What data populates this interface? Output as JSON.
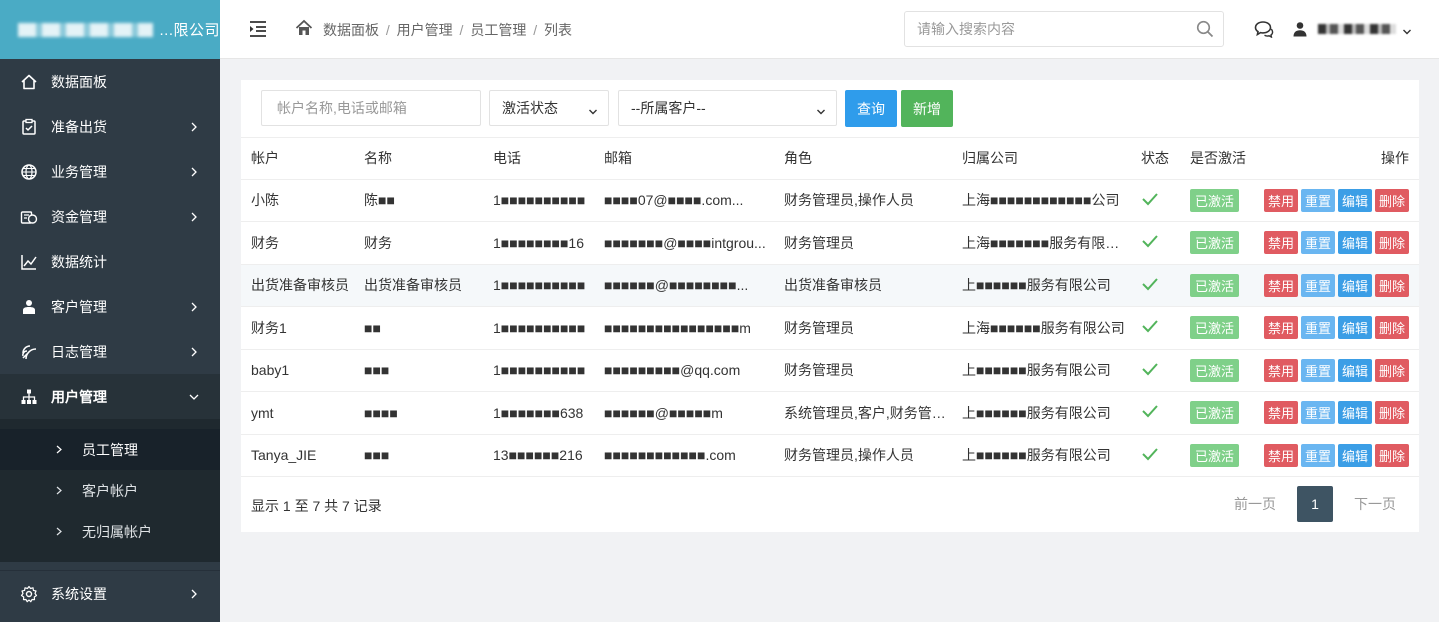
{
  "brand": {
    "title_suffix": "...限公司"
  },
  "sidebar": {
    "items": [
      {
        "label": "数据面板",
        "icon": "home-icon",
        "has_children": false
      },
      {
        "label": "准备出货",
        "icon": "clipboard-icon",
        "has_children": true
      },
      {
        "label": "业务管理",
        "icon": "globe-icon",
        "has_children": true
      },
      {
        "label": "资金管理",
        "icon": "money-icon",
        "has_children": true
      },
      {
        "label": "数据统计",
        "icon": "line-chart-icon",
        "has_children": false
      },
      {
        "label": "客户管理",
        "icon": "person-icon",
        "has_children": true
      },
      {
        "label": "日志管理",
        "icon": "log-icon",
        "has_children": true
      },
      {
        "label": "用户管理",
        "icon": "org-chart-icon",
        "has_children": true,
        "open": true
      }
    ],
    "sub_items": [
      {
        "label": "员工管理",
        "active": true
      },
      {
        "label": "客户帐户",
        "active": false
      },
      {
        "label": "无归属帐户",
        "active": false
      }
    ],
    "bottom": {
      "label": "系统设置",
      "icon": "gear-icon"
    }
  },
  "header": {
    "breadcrumb": [
      "数据面板",
      "用户管理",
      "员工管理",
      "列表"
    ],
    "search_placeholder": "请输入搜索内容",
    "user_name": "■■ ■ ■"
  },
  "toolbar": {
    "account_placeholder": "帐户名称,电话或邮箱",
    "status_select": "激活状态",
    "customer_select": "--所属客户--",
    "query_label": "查询",
    "add_label": "新增"
  },
  "table": {
    "headers": [
      "帐户",
      "名称",
      "电话",
      "邮箱",
      "角色",
      "归属公司",
      "状态",
      "是否激活",
      "操作"
    ],
    "rows": [
      {
        "account": "小陈",
        "name": "陈■■",
        "phone": "1■■■■■■■■■■",
        "email": "■■■■07@■■■■.com...",
        "role": "财务管理员,操作人员",
        "company": "上海■■■■■■■■■■■■公司",
        "active": "已激活"
      },
      {
        "account": "财务",
        "name": "财务",
        "phone": "1■■■■■■■■16",
        "email": "■■■■■■■@■■■■intgrou...",
        "role": "财务管理员",
        "company": "上海■■■■■■■服务有限公司",
        "active": "已激活"
      },
      {
        "account": "出货准备审核员",
        "name": "出货准备审核员",
        "phone": "1■■■■■■■■■■",
        "email": "■■■■■■@■■■■■■■■...",
        "role": "出货准备审核员",
        "company": "上■■■■■■服务有限公司",
        "active": "已激活"
      },
      {
        "account": "财务1",
        "name": "■■",
        "phone": "1■■■■■■■■■■",
        "email": "■■■■■■■■■■■■■■■■m",
        "role": "财务管理员",
        "company": "上海■■■■■■服务有限公司",
        "active": "已激活"
      },
      {
        "account": "baby1",
        "name": "■■■",
        "phone": "1■■■■■■■■■■",
        "email": "■■■■■■■■■@qq.com",
        "role": "财务管理员",
        "company": "上■■■■■■服务有限公司",
        "active": "已激活"
      },
      {
        "account": "ymt",
        "name": "■■■■",
        "phone": "1■■■■■■■638",
        "email": "■■■■■■@■■■■■m",
        "role": "系统管理员,客户,财务管理...",
        "company": "上■■■■■■服务有限公司",
        "active": "已激活"
      },
      {
        "account": "Tanya_JIE",
        "name": "■■■",
        "phone": "13■■■■■■216",
        "email": "■■■■■■■■■■■■.com",
        "role": "财务管理员,操作人员",
        "company": "上■■■■■■服务有限公司",
        "active": "已激活"
      }
    ],
    "op_labels": {
      "disable": "禁用",
      "reset": "重置",
      "edit": "编辑",
      "delete": "删除"
    }
  },
  "footer": {
    "info": "显示 1 至 7 共 7 记录",
    "prev": "前一页",
    "current": "1",
    "next": "下一页"
  },
  "colors": {
    "brand_bg": "#4aabc5",
    "sidebar_bg": "#2f3b45",
    "query_btn": "#2f9ceb",
    "add_btn": "#52b45b",
    "active_badge": "#7fd089",
    "danger": "#e05b61",
    "pager_current": "#3e5463"
  }
}
